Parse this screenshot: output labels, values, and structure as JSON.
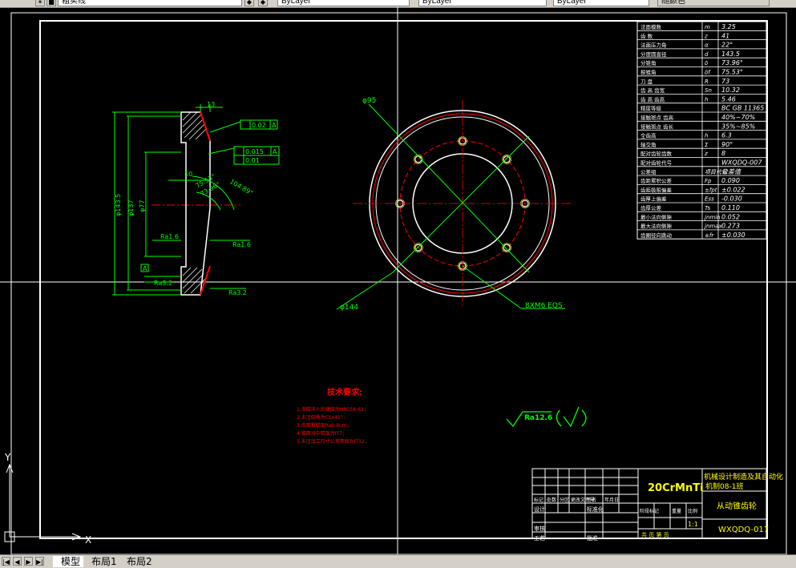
{
  "toolbar": {
    "layer_name": "粗实线",
    "linetype": "ByLayer",
    "lineweight": "ByLayer",
    "color": "ByLayer",
    "plotstyle": "随颜色"
  },
  "gear_params": [
    [
      "法面模数",
      "m",
      "3.25"
    ],
    [
      "齿    数",
      "z",
      "41"
    ],
    [
      "法面压力角",
      "α",
      "22°"
    ],
    [
      "分度圆直径",
      "d",
      "143.5"
    ],
    [
      "分锥角",
      "δ",
      "73.96°"
    ],
    [
      "根锥角",
      "δf",
      "75.53°"
    ],
    [
      "刀  盘",
      "R",
      "73"
    ],
    [
      "齿  高 齿宽",
      "Sn",
      "10.32"
    ],
    [
      "齿  高 齿高",
      "h",
      "5.46"
    ],
    [
      "精度等级",
      "",
      "BC GB 11365"
    ],
    [
      "接触斑点 齿高",
      "",
      "40%~70%"
    ],
    [
      "接触斑点 齿长",
      "",
      "35%~85%"
    ],
    [
      "全齿高",
      "h",
      "6.3"
    ],
    [
      "轴交角",
      "Σ",
      "90°"
    ],
    [
      "配对齿轮齿数",
      "z",
      "8"
    ],
    [
      "配对齿轮代号",
      "",
      "WXQDQ-007"
    ],
    [
      "公差组",
      "项目代号",
      "公差值"
    ],
    [
      "齿距累积公差",
      "Fp",
      "0.090"
    ],
    [
      "齿距极限偏差",
      "±fpt",
      "±0.022"
    ],
    [
      "齿厚上偏差",
      "Ess",
      "-0.030"
    ],
    [
      "齿厚公差",
      "Ts",
      "0.110"
    ],
    [
      "最小法向侧隙",
      "jnmin",
      "0.052"
    ],
    [
      "最大法向侧隙",
      "jnmax",
      "0.273"
    ],
    [
      "齿圈径向跳动",
      "±fr",
      "±0.030"
    ]
  ],
  "dims": {
    "width_13": "13",
    "dia_143_5": "φ143.5",
    "dia_137": "φ137",
    "dia_77": "φ77",
    "len_10": "10",
    "ang_1": "104.89°",
    "ang_2": "75.53°",
    "ang_3": "73.96°",
    "tol_1": "0.02",
    "tol_1_ref": "A",
    "tol_2": "0.015",
    "tol_2_ref": "A",
    "tol_3": "0.01",
    "datum": "A",
    "rough_1": "Ra1.6",
    "rough_2": "Ra1.6",
    "rough_3": "Ra3.2",
    "rough_4": "Ra3.2",
    "circle_95": "φ95",
    "circle_144": "φ144",
    "holes": "8XM6 EQS"
  },
  "notes": {
    "title": "技术要求:",
    "lines": [
      "1.渗碳淬火后硬度为HRC58-62；",
      "2.未注倒角为C1x45°；",
      "3.齿面粗糙度Ra0.8um；",
      "4.锥面对中精度为IT7；",
      "5.未注加工尺寸公差等级为IT12。"
    ]
  },
  "roughness": {
    "label": "Ra12.6"
  },
  "title_block": {
    "material": "20CrMnTi",
    "company": "机械设计制造及其自动化",
    "company2": "机制08-1班",
    "drawing_name": "从动锥齿轮",
    "drawing_no": "WXQDQ-017",
    "scale": "1:1",
    "headers": [
      "标记",
      "处数",
      "分区",
      "更改文件号",
      "签名",
      "年月日"
    ],
    "row_design": "设计",
    "row_std": "标准化",
    "row_check": "审核",
    "row_craft": "工艺",
    "row_approve": "批准",
    "stage": "阶段标记",
    "weight": "重量",
    "ratio": "比例",
    "sheets": "共   页   第   页"
  },
  "tabs": {
    "model": "模型",
    "layout1": "布局1",
    "layout2": "布局2"
  },
  "colors": {
    "white": "#ffffff",
    "green": "#00ff00",
    "red": "#ff0000",
    "cyan": "#00ffff",
    "yellow": "#ffff00"
  }
}
